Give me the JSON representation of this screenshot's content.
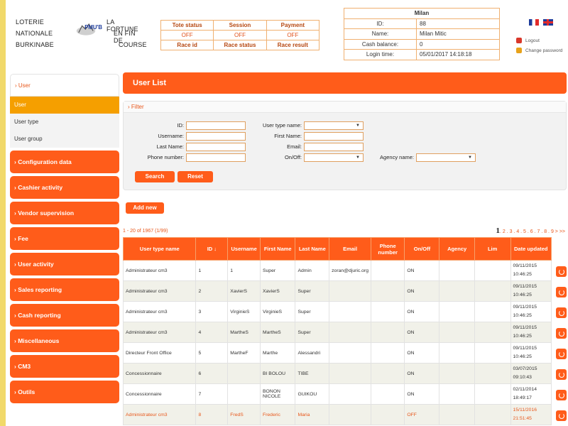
{
  "logo": {
    "left_top": "LOTERIE",
    "left_mid": "NATIONALE",
    "left_bot": "BURKINABE",
    "right_top": "LA FORTUNE",
    "right_mid": "EN FIN DE",
    "right_bot": "COURSE",
    "brand": "PMU'B"
  },
  "status_table": {
    "headers": [
      "Tote status",
      "Session",
      "Payment"
    ],
    "values": [
      "OFF",
      "OFF",
      "OFF"
    ],
    "headers2": [
      "Race id",
      "Race status",
      "Race result"
    ]
  },
  "user_panel": {
    "name": "Milan",
    "rows": [
      {
        "label": "ID:",
        "value": "88"
      },
      {
        "label": "Name:",
        "value": "Milan Mitic"
      },
      {
        "label": "Cash balance:",
        "value": "0"
      },
      {
        "label": "Login time:",
        "value": "05/01/2017 14:18:18"
      }
    ]
  },
  "header_links": {
    "logout": "Logout",
    "change_password": "Change password"
  },
  "sidebar": {
    "head": "User",
    "subitems": [
      "User",
      "User type",
      "User group"
    ],
    "items": [
      "Configuration data",
      "Cashier activity",
      "Vendor supervision",
      "Fee",
      "User activity",
      "Sales reporting",
      "Cash reporting",
      "Miscellaneous",
      "CM3",
      "Outils"
    ]
  },
  "main": {
    "title": "User List",
    "filter": {
      "head": "Filter",
      "id_label": "ID:",
      "username_label": "Username:",
      "lastname_label": "Last Name:",
      "phone_label": "Phone number:",
      "usertype_label": "User type name:",
      "firstname_label": "First Name:",
      "email_label": "Email:",
      "onoff_label": "On/Off:",
      "agency_label": "Agency name:",
      "search_btn": "Search",
      "reset_btn": "Reset"
    },
    "add_new": "Add new",
    "count": "1 - 20 of 1967 (1/99)",
    "pager": {
      "current": "1",
      "rest": ". 2 . 3 . 4 . 5 . 6 . 7 . 8 . 9 > >>"
    }
  },
  "table": {
    "headers": [
      "User type name",
      "ID",
      "Username",
      "First Name",
      "Last Name",
      "Email",
      "Phone number",
      "On/Off",
      "Agency",
      "Lim",
      "Date updated"
    ],
    "rows": [
      [
        "Administrateur cm3",
        "1",
        "1",
        "Super",
        "Admin",
        "zoran@djuric.org",
        "",
        "ON",
        "",
        "",
        "09/11/2015 10:46:25"
      ],
      [
        "Administrateur cm3",
        "2",
        "XavierS",
        "XavierS",
        "Super",
        "",
        "",
        "ON",
        "",
        "",
        "09/11/2015 10:46:25"
      ],
      [
        "Administrateur cm3",
        "3",
        "VirginieS",
        "VirginieS",
        "Super",
        "",
        "",
        "ON",
        "",
        "",
        "09/11/2015 10:46:25"
      ],
      [
        "Administrateur cm3",
        "4",
        "MartheS",
        "MartheS",
        "Super",
        "",
        "",
        "ON",
        "",
        "",
        "09/11/2015 10:46:25"
      ],
      [
        "Directeur Front Office",
        "5",
        "MartheF",
        "Marthe",
        "Alessandri",
        "",
        "",
        "ON",
        "",
        "",
        "09/11/2015 10:46:25"
      ],
      [
        "Concessionnaire",
        "6",
        "",
        "BI BOLOU",
        "TIBE",
        "",
        "",
        "ON",
        "",
        "",
        "03/07/2015 09:10:43"
      ],
      [
        "Concessionnaire",
        "7",
        "",
        "BONON NICOLE",
        "GUIKOU",
        "",
        "",
        "ON",
        "",
        "",
        "02/11/2014 18:49:17"
      ],
      [
        "Administrateur cm3",
        "8",
        "FredS",
        "Frederic",
        "Maria",
        "",
        "",
        "OFF",
        "",
        "",
        "15/11/2016 21:51:45"
      ]
    ]
  }
}
